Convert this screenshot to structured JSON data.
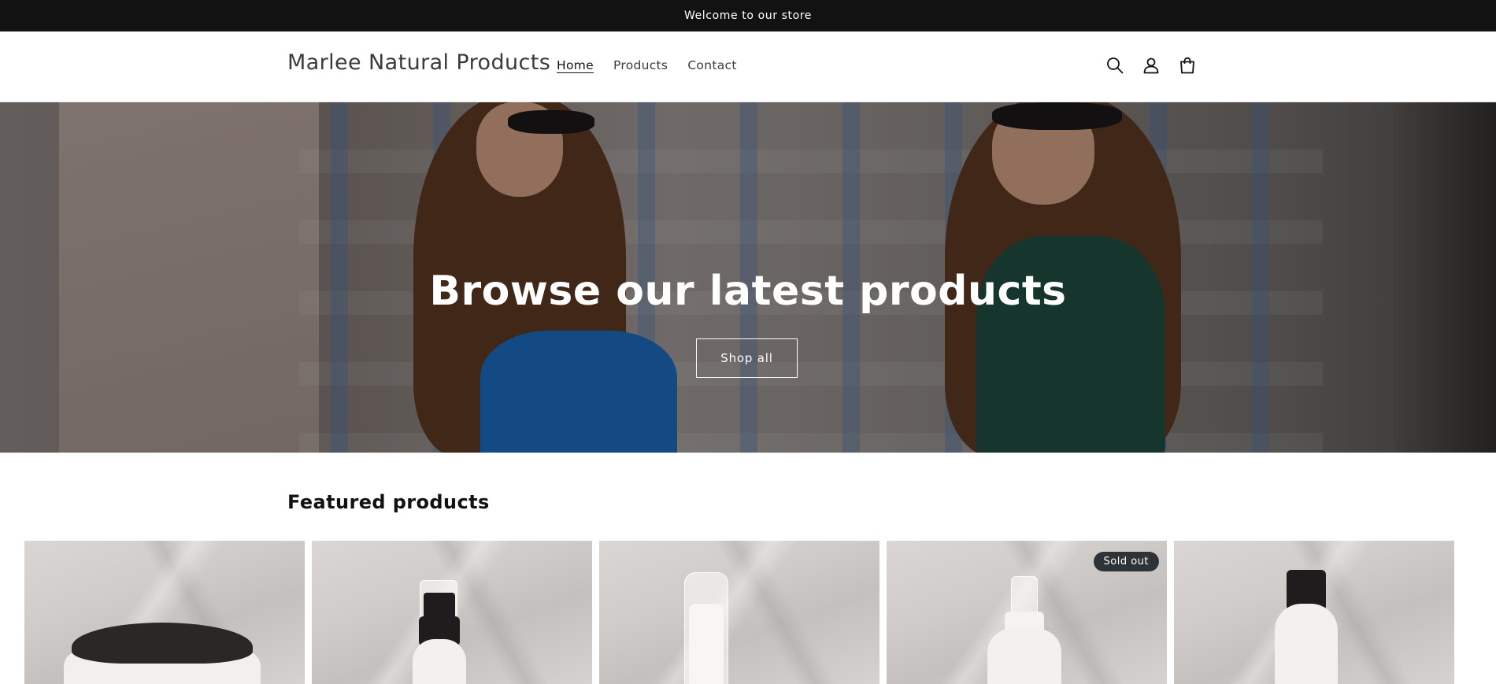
{
  "announcement": {
    "text": "Welcome to our store"
  },
  "header": {
    "store_name": "Marlee Natural Products",
    "nav": [
      {
        "label": "Home",
        "active": true
      },
      {
        "label": "Products",
        "active": false
      },
      {
        "label": "Contact",
        "active": false
      }
    ],
    "icons": [
      "search-icon",
      "account-icon",
      "cart-icon"
    ]
  },
  "hero": {
    "title": "Browse our latest products",
    "button_label": "Shop all"
  },
  "featured": {
    "title": "Featured products",
    "products": [
      {
        "image": "product-jar-image",
        "sold_out": false
      },
      {
        "image": "product-pump-bottle-image",
        "sold_out": false
      },
      {
        "image": "product-airless-bottle-image",
        "sold_out": false
      },
      {
        "image": "product-spray-bottle-image",
        "sold_out": true,
        "badge": "Sold out"
      },
      {
        "image": "product-cap-bottle-image",
        "sold_out": false
      }
    ]
  },
  "colors": {
    "announcement_bg": "#121212",
    "text": "#121212",
    "badge_bg": "#2e3338"
  }
}
